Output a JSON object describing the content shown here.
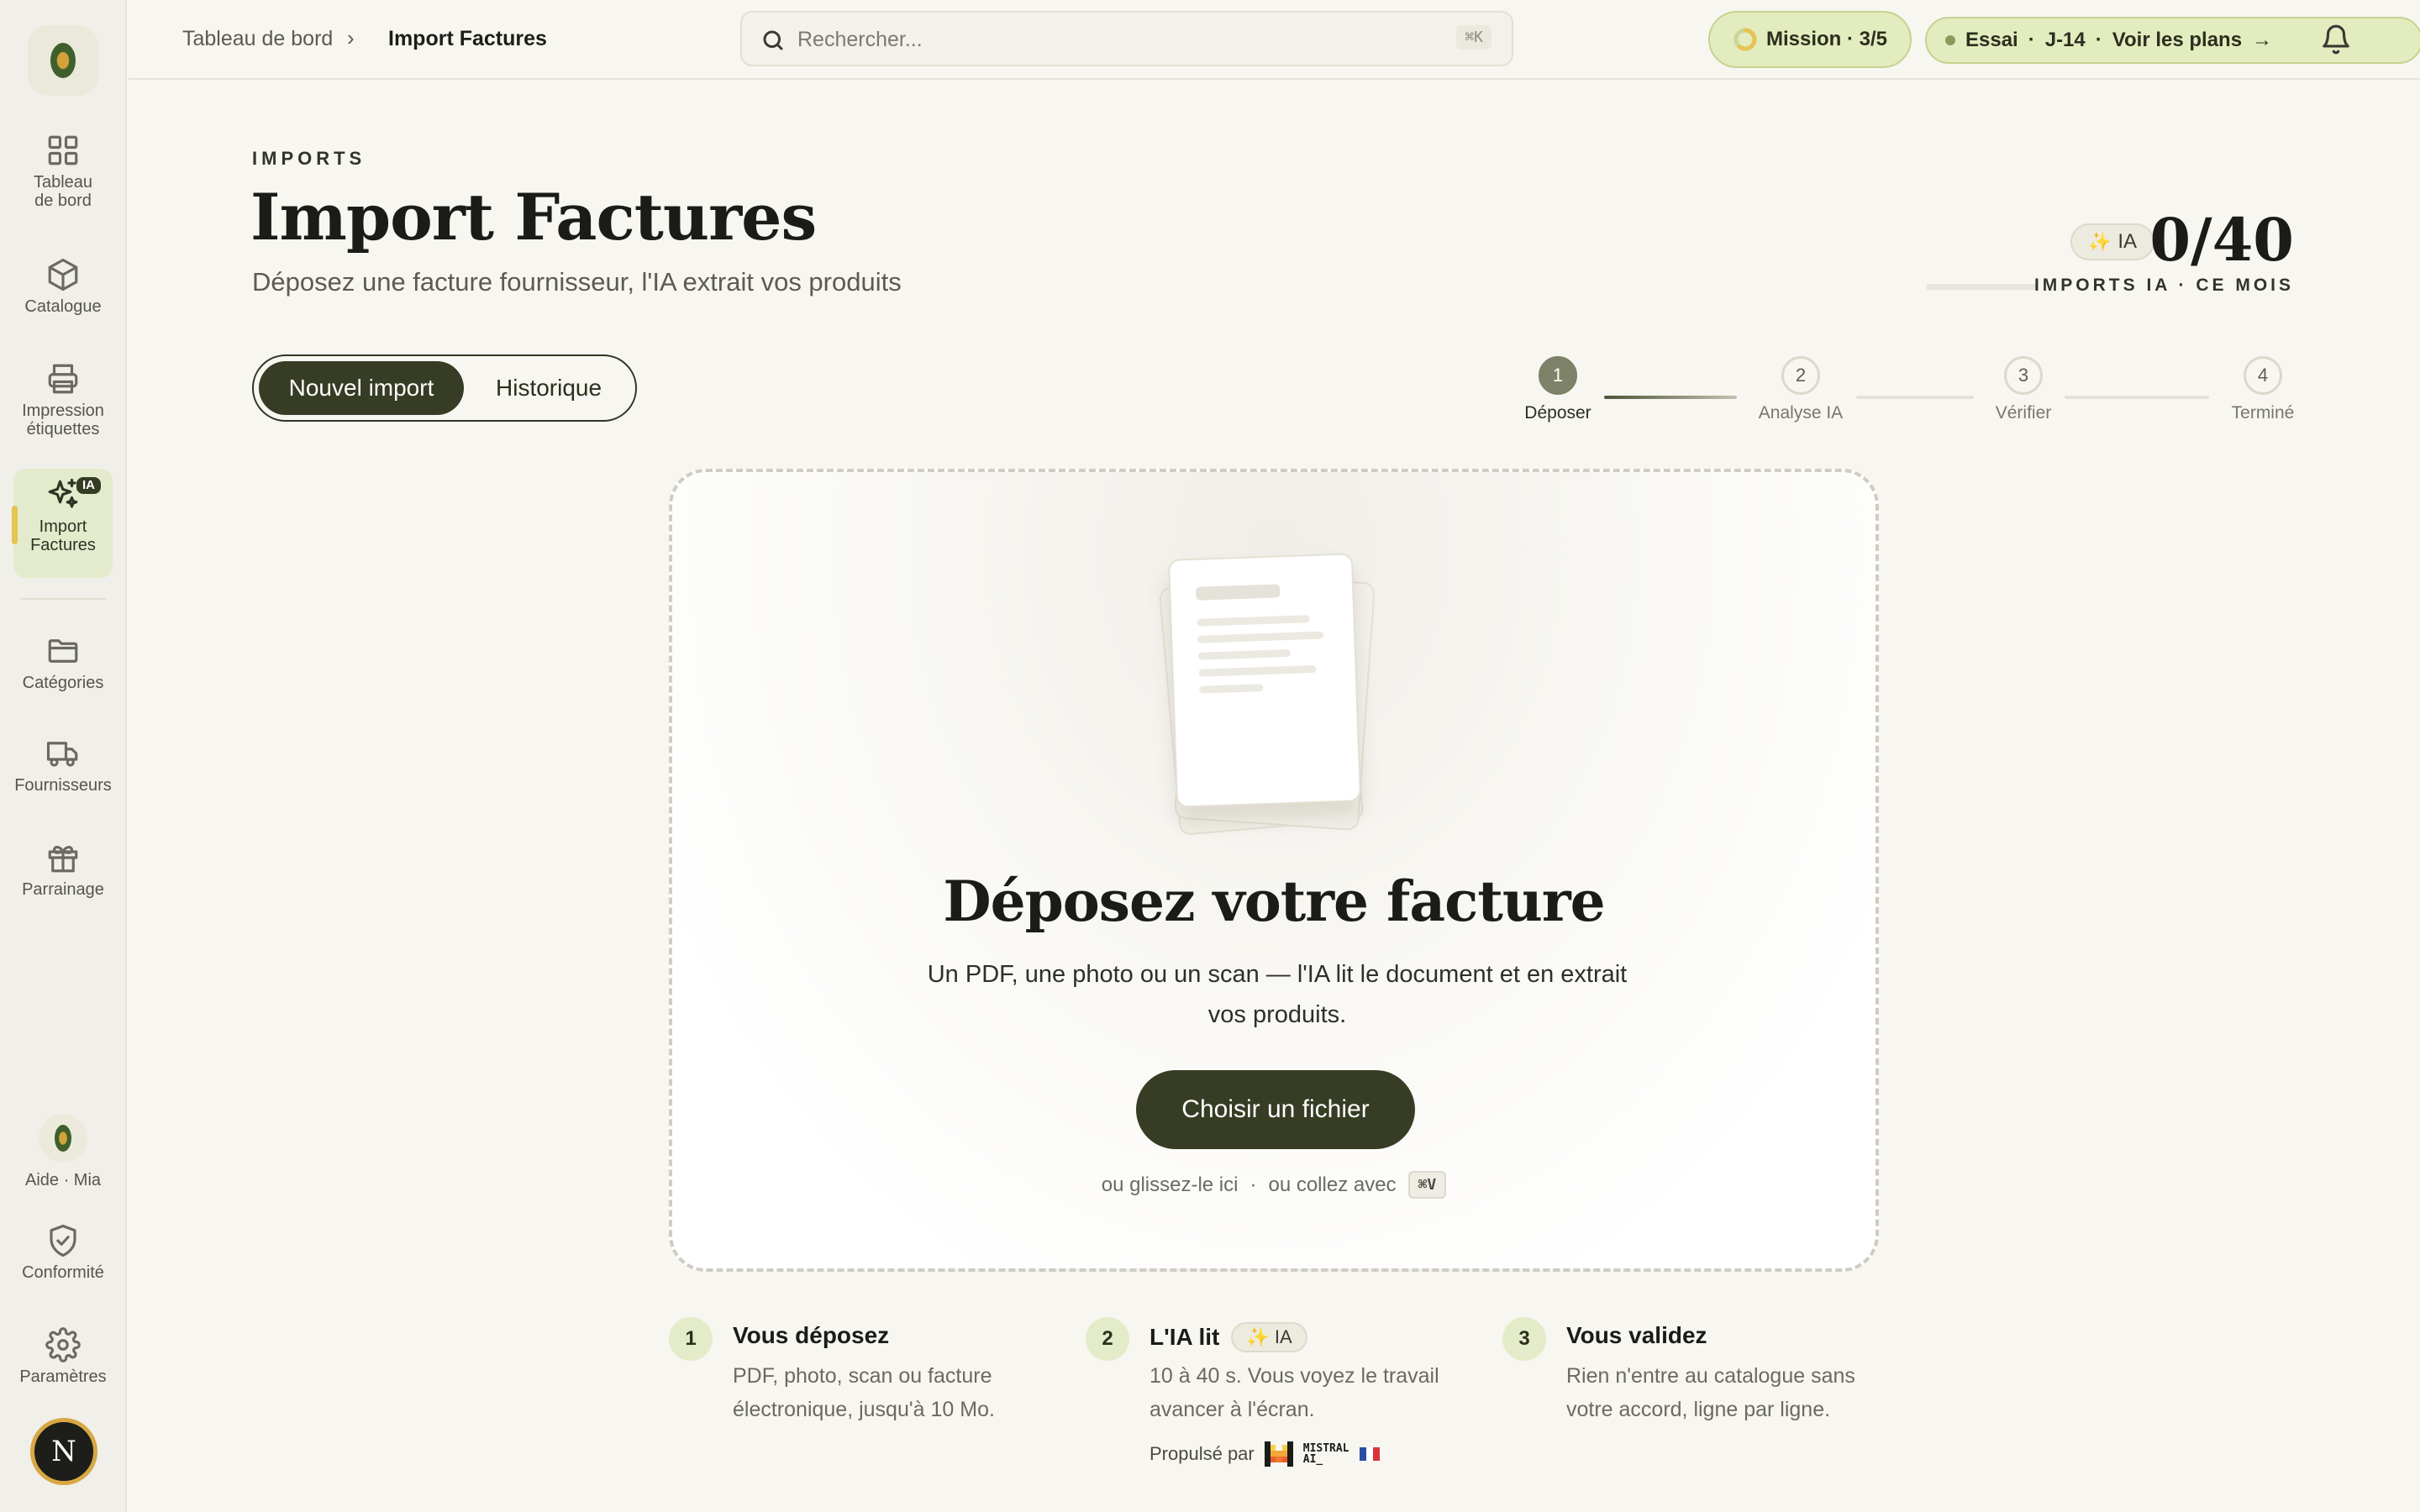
{
  "sidebar": {
    "items": [
      {
        "label": "Tableau\nde bord",
        "icon": "dashboard-icon"
      },
      {
        "label": "Catalogue",
        "icon": "box-icon"
      },
      {
        "label": "Impression\nétiquettes",
        "icon": "printer-icon"
      },
      {
        "label": "Import\nFactures",
        "icon": "sparkles-icon",
        "badge": "IA",
        "active": true
      },
      {
        "label": "Catégories",
        "icon": "folder-icon"
      },
      {
        "label": "Fournisseurs",
        "icon": "truck-icon"
      },
      {
        "label": "Parrainage",
        "icon": "gift-icon"
      },
      {
        "label": "Aide · Mia",
        "icon": "olive-icon"
      },
      {
        "label": "Conformité",
        "icon": "shield-check-icon"
      },
      {
        "label": "Paramètres",
        "icon": "gear-icon"
      }
    ],
    "user_initial": "N"
  },
  "topbar": {
    "breadcrumb": [
      "Tableau de bord",
      "Import Factures"
    ],
    "search_placeholder": "Rechercher...",
    "search_shortcut": "⌘K",
    "mission": "Mission · 3/5",
    "mission_progress": 0.6,
    "trial": {
      "label": "Essai",
      "days": "J-14",
      "cta": "Voir les plans"
    }
  },
  "header": {
    "eyebrow": "IMPORTS",
    "title": "Import Factures",
    "subtitle": "Déposez une facture fournisseur, l'IA extrait vos produits",
    "badge": "IA",
    "counter": "0/40",
    "counter_label": "IMPORTS IA · CE MOIS",
    "counter_progress": 0
  },
  "tabs": [
    {
      "label": "Nouvel import",
      "active": true
    },
    {
      "label": "Historique",
      "active": false
    }
  ],
  "stepper": [
    {
      "num": "1",
      "label": "Déposer",
      "active": true
    },
    {
      "num": "2",
      "label": "Analyse IA",
      "active": false
    },
    {
      "num": "3",
      "label": "Vérifier",
      "active": false
    },
    {
      "num": "4",
      "label": "Terminé",
      "active": false
    }
  ],
  "dropzone": {
    "title": "Déposez votre facture",
    "description": "Un PDF, une photo ou un scan — l'IA lit le document et en extrait vos produits.",
    "button": "Choisir un fichier",
    "hint_drag": "ou glissez-le ici",
    "hint_sep": "·",
    "hint_paste": "ou collez avec",
    "paste_shortcut": "⌘V"
  },
  "how_it_works": [
    {
      "num": "1",
      "title": "Vous déposez",
      "desc": "PDF, photo, scan ou facture électronique, jusqu'à 10 Mo."
    },
    {
      "num": "2",
      "title": "L'IA lit",
      "badge": "IA",
      "desc": "10 à 40 s. Vous voyez le travail avancer à l'écran."
    },
    {
      "num": "3",
      "title": "Vous validez",
      "desc": "Rien n'entre au catalogue sans votre accord, ligne par ligne."
    }
  ],
  "powered_by": {
    "label": "Propulsé par",
    "brand_line1": "MISTRAL",
    "brand_line2": "AI_"
  },
  "colors": {
    "accent": "#363d24",
    "active_bg": "#e4ebcd",
    "badge_green": "#e3ecbf",
    "gold": "#e6c450"
  }
}
